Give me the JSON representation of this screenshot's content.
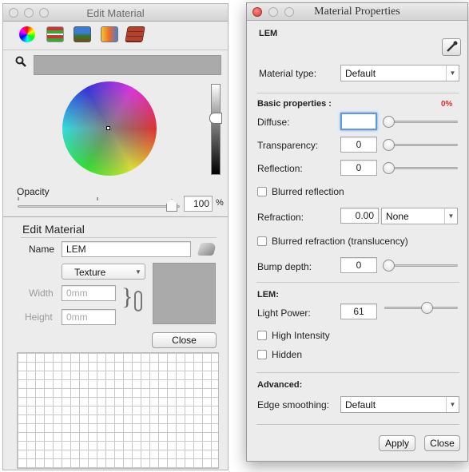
{
  "edit_window": {
    "title": "Edit Material",
    "tabs": [
      "colors-tab-icon",
      "texture-list-tab-icon",
      "image-tab-icon",
      "palette-tab-icon",
      "brick-tab-icon"
    ],
    "opacity_label": "Opacity",
    "opacity_value": "100",
    "opacity_unit": "%",
    "opacity_fraction": 1.0,
    "section_title": "Edit Material",
    "name_label": "Name",
    "name_value": "LEM",
    "texture_select": "Texture",
    "width_label": "Width",
    "width_placeholder": "0mm",
    "height_label": "Height",
    "height_placeholder": "0mm",
    "close_label": "Close"
  },
  "props_window": {
    "title": "Material Properties",
    "material_name": "LEM",
    "material_type_label": "Material type:",
    "material_type_value": "Default",
    "basic_header": "Basic properties :",
    "percent": "0%",
    "diffuse_label": "Diffuse:",
    "diffuse_value": "",
    "transparency_label": "Transparency:",
    "transparency_value": "0",
    "reflection_label": "Reflection:",
    "reflection_value": "0",
    "blurred_reflection_label": "Blurred reflection",
    "refraction_label": "Refraction:",
    "refraction_value": "0.00",
    "refraction_select": "None",
    "blurred_refraction_label": "Blurred refraction (translucency)",
    "bump_label": "Bump depth:",
    "bump_value": "0",
    "lem_header": "LEM:",
    "light_power_label": "Light Power:",
    "light_power_value": "61",
    "high_intensity_label": "High Intensity",
    "hidden_label": "Hidden",
    "advanced_header": "Advanced:",
    "edge_label": "Edge smoothing:",
    "edge_value": "Default",
    "apply_label": "Apply",
    "close_label": "Close"
  },
  "colors": {
    "accent_red": "#e0302a",
    "focus_blue": "#5b9ae0"
  }
}
